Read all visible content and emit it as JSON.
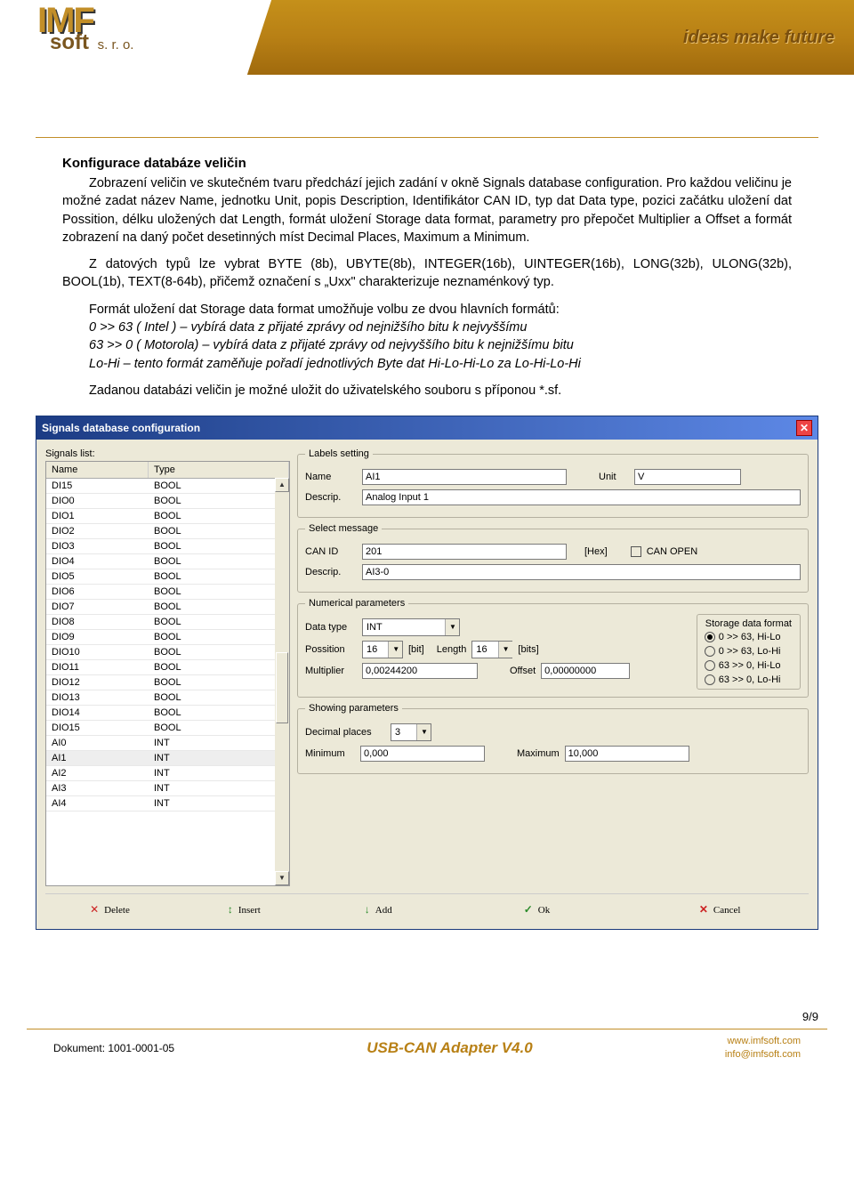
{
  "header": {
    "logo_top": "IMF",
    "logo_bottom": "soft",
    "logo_suffix": "s. r. o.",
    "tagline": "ideas make future"
  },
  "doc": {
    "title": "Konfigurace databáze veličin",
    "p1": "Zobrazení veličin ve skutečném tvaru předchází jejich zadání v okně Signals database configuration. Pro každou veličinu je možné zadat název Name, jednotku Unit, popis Description, Identifikátor CAN ID, typ dat Data type, pozici začátku uložení dat Possition, délku uložených dat Length, formát uložení Storage data format, parametry pro přepočet Multiplier a Offset a formát zobrazení na daný počet desetinných míst Decimal Places, Maximum a Minimum.",
    "p2": "Z datových typů lze vybrat BYTE (8b), UBYTE(8b), INTEGER(16b), UINTEGER(16b), LONG(32b), ULONG(32b), BOOL(1b), TEXT(8-64b), přičemž označení s „Uxx\" charakterizuje neznaménkový typ.",
    "p3_a": "Formát uložení dat Storage data format umožňuje volbu ze dvou hlavních formátů:",
    "p3_b": "0 >> 63 ( Intel ) – vybírá data z přijaté zprávy od nejnižšího bitu k nejvyššímu",
    "p3_c": "63 >> 0 ( Motorola) – vybírá data z přijaté zprávy od nejvyššího bitu k nejnižšímu bitu",
    "p3_d": "Lo-Hi – tento formát zaměňuje pořadí jednotlivých Byte dat Hi-Lo-Hi-Lo za Lo-Hi-Lo-Hi",
    "p4": "Zadanou databázi veličin je možné uložit do uživatelského souboru s příponou *.sf."
  },
  "dialog": {
    "title": "Signals database configuration",
    "signals_list_label": "Signals list:",
    "grid_headers": {
      "name": "Name",
      "type": "Type"
    },
    "rows": [
      {
        "n": "DI15",
        "t": "BOOL"
      },
      {
        "n": "DIO0",
        "t": "BOOL"
      },
      {
        "n": "DIO1",
        "t": "BOOL"
      },
      {
        "n": "DIO2",
        "t": "BOOL"
      },
      {
        "n": "DIO3",
        "t": "BOOL"
      },
      {
        "n": "DIO4",
        "t": "BOOL"
      },
      {
        "n": "DIO5",
        "t": "BOOL"
      },
      {
        "n": "DIO6",
        "t": "BOOL"
      },
      {
        "n": "DIO7",
        "t": "BOOL"
      },
      {
        "n": "DIO8",
        "t": "BOOL"
      },
      {
        "n": "DIO9",
        "t": "BOOL"
      },
      {
        "n": "DIO10",
        "t": "BOOL"
      },
      {
        "n": "DIO11",
        "t": "BOOL"
      },
      {
        "n": "DIO12",
        "t": "BOOL"
      },
      {
        "n": "DIO13",
        "t": "BOOL"
      },
      {
        "n": "DIO14",
        "t": "BOOL"
      },
      {
        "n": "DIO15",
        "t": "BOOL"
      },
      {
        "n": "AI0",
        "t": "INT"
      },
      {
        "n": "AI1",
        "t": "INT"
      },
      {
        "n": "AI2",
        "t": "INT"
      },
      {
        "n": "AI3",
        "t": "INT"
      },
      {
        "n": "AI4",
        "t": "INT"
      }
    ],
    "selected_row": 18,
    "labels_setting": {
      "legend": "Labels setting",
      "name_label": "Name",
      "name_value": "AI1",
      "unit_label": "Unit",
      "unit_value": "V",
      "descrip_label": "Descrip.",
      "descrip_value": "Analog Input 1"
    },
    "select_message": {
      "legend": "Select message",
      "canid_label": "CAN ID",
      "canid_value": "201",
      "hex": "[Hex]",
      "canopen_label": "CAN OPEN",
      "canopen_checked": false,
      "descrip_label": "Descrip.",
      "descrip_value": "AI3-0"
    },
    "numerical": {
      "legend": "Numerical parameters",
      "data_type_label": "Data type",
      "data_type_value": "INT",
      "possition_label": "Possition",
      "possition_value": "16",
      "bit": "[bit]",
      "length_label": "Length",
      "length_value": "16",
      "bits": "[bits]",
      "multiplier_label": "Multiplier",
      "multiplier_value": "0,00244200",
      "offset_label": "Offset",
      "offset_value": "0,00000000",
      "storage_legend": "Storage data format",
      "radios": [
        {
          "label": "0 >> 63, Hi-Lo",
          "on": true
        },
        {
          "label": "0 >> 63, Lo-Hi",
          "on": false
        },
        {
          "label": "63 >> 0, Hi-Lo",
          "on": false
        },
        {
          "label": "63 >> 0, Lo-Hi",
          "on": false
        }
      ]
    },
    "showing": {
      "legend": "Showing parameters",
      "decimal_label": "Decimal places",
      "decimal_value": "3",
      "min_label": "Minimum",
      "min_value": "0,000",
      "max_label": "Maximum",
      "max_value": "10,000"
    },
    "buttons": {
      "delete": "Delete",
      "insert": "Insert",
      "add": "Add",
      "ok": "Ok",
      "cancel": "Cancel"
    }
  },
  "footer": {
    "page": "9/9",
    "docnum_label": "Dokument:",
    "docnum": "1001-0001-05",
    "center": "USB-CAN Adapter V4.0",
    "url": "www.imfsoft.com",
    "email": "info@imfsoft.com"
  }
}
